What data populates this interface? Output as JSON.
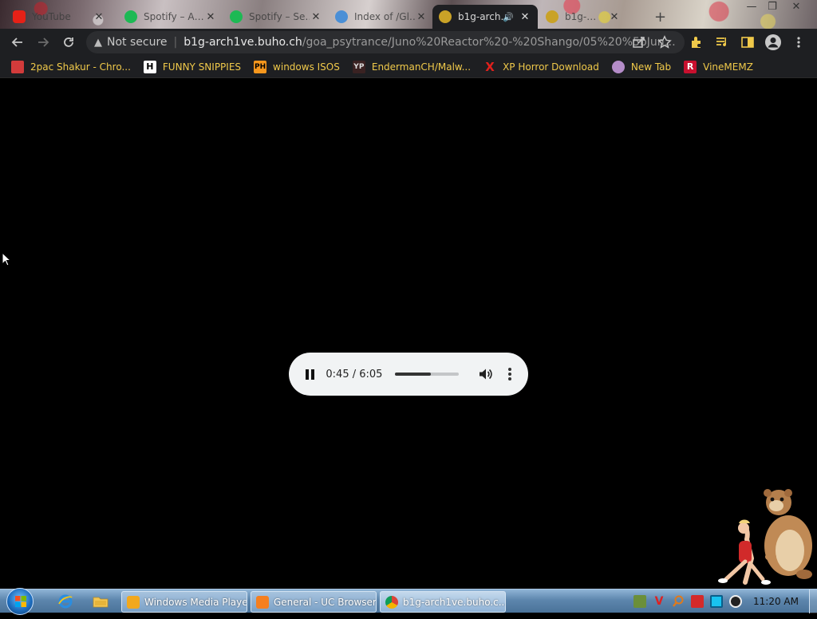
{
  "browser": {
    "tabs": [
      {
        "title": "YouTube",
        "favicon_color": "#e62117"
      },
      {
        "title": "Spotify – A…",
        "favicon_color": "#1db954"
      },
      {
        "title": "Spotify – Se…",
        "favicon_color": "#1db954"
      },
      {
        "title": "Index of /Gl…",
        "favicon_color": "#4a8fd6"
      },
      {
        "title": "b1g-arch…",
        "favicon_color": "#c9a227",
        "active": true,
        "audio": true
      },
      {
        "title": "b1g-…",
        "favicon_color": "#c9a227"
      }
    ],
    "address": {
      "security_label": "Not secure",
      "host": "b1g-arch1ve.buho.ch",
      "path": "/goa_psytrance/Juno%20Reactor%20-%20Shango/05%20%5bJuno..."
    },
    "bookmarks": [
      {
        "label": "2pac Shakur - Chro...",
        "icon": "bookmark-2pac-icon",
        "icon_color": "#d23b3b"
      },
      {
        "label": "FUNNY SNIPPIES",
        "icon": "letter-h-icon",
        "icon_color": "#ffffff"
      },
      {
        "label": "windows ISOS",
        "icon": "ph-logo-icon",
        "icon_color": "#f7971d"
      },
      {
        "label": "EndermanCH/Malw...",
        "icon": "yp-logo-icon",
        "icon_color": "#8a3a3a"
      },
      {
        "label": "XP Horror Download",
        "icon": "x-logo-icon",
        "icon_color": "#e0201c"
      },
      {
        "label": "New Tab",
        "icon": "new-tab-icon",
        "icon_color": "#b48cc8"
      },
      {
        "label": "VineMEMZ",
        "icon": "r-logo-icon",
        "icon_color": "#c8102e"
      }
    ]
  },
  "player": {
    "current_time": "0:45",
    "duration": "6:05",
    "time_display": "0:45 / 6:05",
    "progress": 0.56
  },
  "taskbar": {
    "tasks": [
      {
        "label": "Windows Media Player",
        "icon_color": "#f2a81d"
      },
      {
        "label": "General - UC Browser",
        "icon_color": "#f57f1f"
      },
      {
        "label": "b1g-arch1ve.buho.c...",
        "icon_color": "#4caf50",
        "active": true
      }
    ],
    "clock": "11:20 AM"
  }
}
